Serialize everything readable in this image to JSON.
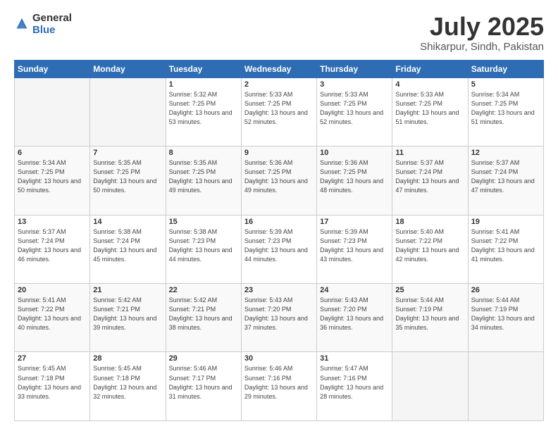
{
  "logo": {
    "general": "General",
    "blue": "Blue"
  },
  "title": {
    "month_year": "July 2025",
    "location": "Shikarpur, Sindh, Pakistan"
  },
  "days_of_week": [
    "Sunday",
    "Monday",
    "Tuesday",
    "Wednesday",
    "Thursday",
    "Friday",
    "Saturday"
  ],
  "weeks": [
    [
      {
        "day": "",
        "sunrise": "",
        "sunset": "",
        "daylight": ""
      },
      {
        "day": "",
        "sunrise": "",
        "sunset": "",
        "daylight": ""
      },
      {
        "day": "1",
        "sunrise": "Sunrise: 5:32 AM",
        "sunset": "Sunset: 7:25 PM",
        "daylight": "Daylight: 13 hours and 53 minutes."
      },
      {
        "day": "2",
        "sunrise": "Sunrise: 5:33 AM",
        "sunset": "Sunset: 7:25 PM",
        "daylight": "Daylight: 13 hours and 52 minutes."
      },
      {
        "day": "3",
        "sunrise": "Sunrise: 5:33 AM",
        "sunset": "Sunset: 7:25 PM",
        "daylight": "Daylight: 13 hours and 52 minutes."
      },
      {
        "day": "4",
        "sunrise": "Sunrise: 5:33 AM",
        "sunset": "Sunset: 7:25 PM",
        "daylight": "Daylight: 13 hours and 51 minutes."
      },
      {
        "day": "5",
        "sunrise": "Sunrise: 5:34 AM",
        "sunset": "Sunset: 7:25 PM",
        "daylight": "Daylight: 13 hours and 51 minutes."
      }
    ],
    [
      {
        "day": "6",
        "sunrise": "Sunrise: 5:34 AM",
        "sunset": "Sunset: 7:25 PM",
        "daylight": "Daylight: 13 hours and 50 minutes."
      },
      {
        "day": "7",
        "sunrise": "Sunrise: 5:35 AM",
        "sunset": "Sunset: 7:25 PM",
        "daylight": "Daylight: 13 hours and 50 minutes."
      },
      {
        "day": "8",
        "sunrise": "Sunrise: 5:35 AM",
        "sunset": "Sunset: 7:25 PM",
        "daylight": "Daylight: 13 hours and 49 minutes."
      },
      {
        "day": "9",
        "sunrise": "Sunrise: 5:36 AM",
        "sunset": "Sunset: 7:25 PM",
        "daylight": "Daylight: 13 hours and 49 minutes."
      },
      {
        "day": "10",
        "sunrise": "Sunrise: 5:36 AM",
        "sunset": "Sunset: 7:25 PM",
        "daylight": "Daylight: 13 hours and 48 minutes."
      },
      {
        "day": "11",
        "sunrise": "Sunrise: 5:37 AM",
        "sunset": "Sunset: 7:24 PM",
        "daylight": "Daylight: 13 hours and 47 minutes."
      },
      {
        "day": "12",
        "sunrise": "Sunrise: 5:37 AM",
        "sunset": "Sunset: 7:24 PM",
        "daylight": "Daylight: 13 hours and 47 minutes."
      }
    ],
    [
      {
        "day": "13",
        "sunrise": "Sunrise: 5:37 AM",
        "sunset": "Sunset: 7:24 PM",
        "daylight": "Daylight: 13 hours and 46 minutes."
      },
      {
        "day": "14",
        "sunrise": "Sunrise: 5:38 AM",
        "sunset": "Sunset: 7:24 PM",
        "daylight": "Daylight: 13 hours and 45 minutes."
      },
      {
        "day": "15",
        "sunrise": "Sunrise: 5:38 AM",
        "sunset": "Sunset: 7:23 PM",
        "daylight": "Daylight: 13 hours and 44 minutes."
      },
      {
        "day": "16",
        "sunrise": "Sunrise: 5:39 AM",
        "sunset": "Sunset: 7:23 PM",
        "daylight": "Daylight: 13 hours and 44 minutes."
      },
      {
        "day": "17",
        "sunrise": "Sunrise: 5:39 AM",
        "sunset": "Sunset: 7:23 PM",
        "daylight": "Daylight: 13 hours and 43 minutes."
      },
      {
        "day": "18",
        "sunrise": "Sunrise: 5:40 AM",
        "sunset": "Sunset: 7:22 PM",
        "daylight": "Daylight: 13 hours and 42 minutes."
      },
      {
        "day": "19",
        "sunrise": "Sunrise: 5:41 AM",
        "sunset": "Sunset: 7:22 PM",
        "daylight": "Daylight: 13 hours and 41 minutes."
      }
    ],
    [
      {
        "day": "20",
        "sunrise": "Sunrise: 5:41 AM",
        "sunset": "Sunset: 7:22 PM",
        "daylight": "Daylight: 13 hours and 40 minutes."
      },
      {
        "day": "21",
        "sunrise": "Sunrise: 5:42 AM",
        "sunset": "Sunset: 7:21 PM",
        "daylight": "Daylight: 13 hours and 39 minutes."
      },
      {
        "day": "22",
        "sunrise": "Sunrise: 5:42 AM",
        "sunset": "Sunset: 7:21 PM",
        "daylight": "Daylight: 13 hours and 38 minutes."
      },
      {
        "day": "23",
        "sunrise": "Sunrise: 5:43 AM",
        "sunset": "Sunset: 7:20 PM",
        "daylight": "Daylight: 13 hours and 37 minutes."
      },
      {
        "day": "24",
        "sunrise": "Sunrise: 5:43 AM",
        "sunset": "Sunset: 7:20 PM",
        "daylight": "Daylight: 13 hours and 36 minutes."
      },
      {
        "day": "25",
        "sunrise": "Sunrise: 5:44 AM",
        "sunset": "Sunset: 7:19 PM",
        "daylight": "Daylight: 13 hours and 35 minutes."
      },
      {
        "day": "26",
        "sunrise": "Sunrise: 5:44 AM",
        "sunset": "Sunset: 7:19 PM",
        "daylight": "Daylight: 13 hours and 34 minutes."
      }
    ],
    [
      {
        "day": "27",
        "sunrise": "Sunrise: 5:45 AM",
        "sunset": "Sunset: 7:18 PM",
        "daylight": "Daylight: 13 hours and 33 minutes."
      },
      {
        "day": "28",
        "sunrise": "Sunrise: 5:45 AM",
        "sunset": "Sunset: 7:18 PM",
        "daylight": "Daylight: 13 hours and 32 minutes."
      },
      {
        "day": "29",
        "sunrise": "Sunrise: 5:46 AM",
        "sunset": "Sunset: 7:17 PM",
        "daylight": "Daylight: 13 hours and 31 minutes."
      },
      {
        "day": "30",
        "sunrise": "Sunrise: 5:46 AM",
        "sunset": "Sunset: 7:16 PM",
        "daylight": "Daylight: 13 hours and 29 minutes."
      },
      {
        "day": "31",
        "sunrise": "Sunrise: 5:47 AM",
        "sunset": "Sunset: 7:16 PM",
        "daylight": "Daylight: 13 hours and 28 minutes."
      },
      {
        "day": "",
        "sunrise": "",
        "sunset": "",
        "daylight": ""
      },
      {
        "day": "",
        "sunrise": "",
        "sunset": "",
        "daylight": ""
      }
    ]
  ]
}
